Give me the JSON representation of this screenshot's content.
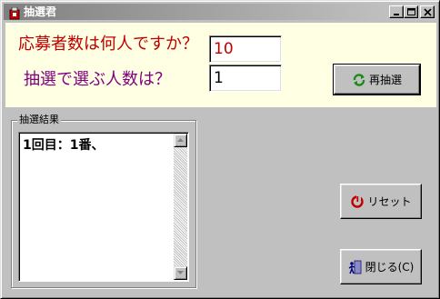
{
  "window": {
    "title": "抽選君",
    "controls": {
      "minimize": "minimize-icon",
      "maximize": "maximize-icon",
      "close": "close-icon"
    }
  },
  "question": {
    "applicants_label": "応募者数は何人ですか？",
    "applicants_value": "10",
    "winners_label": "抽選で選ぶ人数は？",
    "winners_value": "1",
    "colors": {
      "applicants_label": "#c00000",
      "winners_label": "#800080",
      "panel_bg": "#ffffe4"
    }
  },
  "buttons": {
    "redraw": {
      "label": "再抽選",
      "icon": "refresh-icon"
    },
    "reset": {
      "label": "リセット",
      "icon": "reset-icon"
    },
    "close": {
      "label": "閉じる(C)",
      "icon": "exit-door-icon"
    }
  },
  "results": {
    "group_title": "抽選結果",
    "text": "1回目：1番、"
  }
}
